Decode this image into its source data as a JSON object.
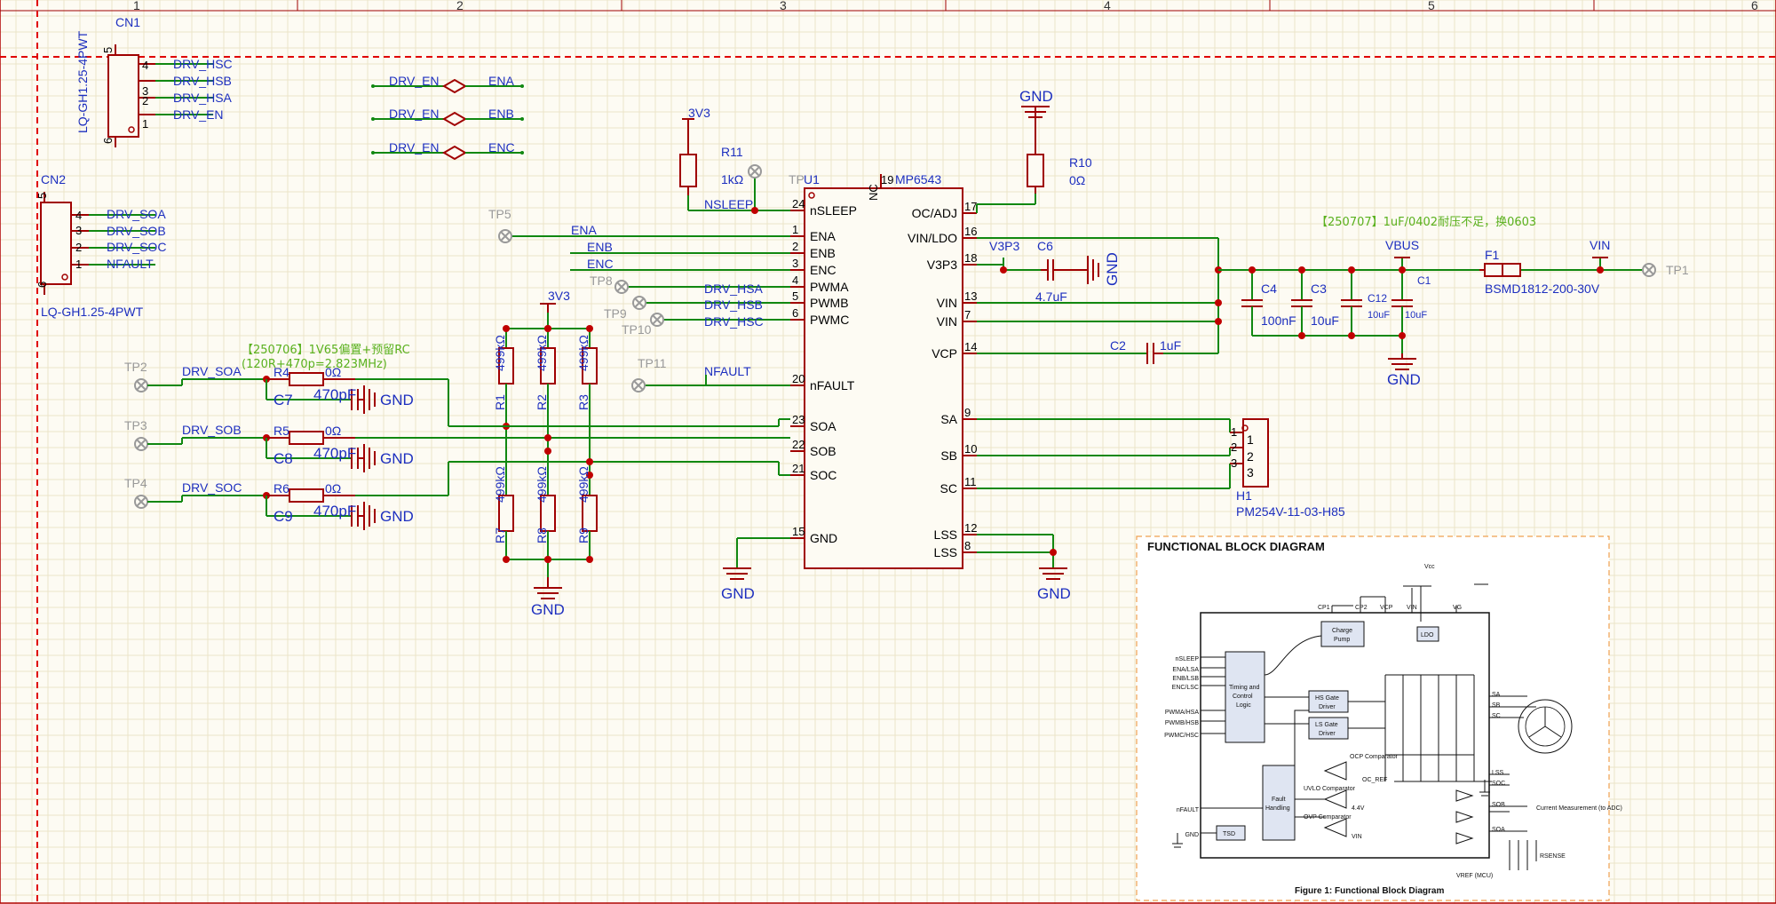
{
  "rulers": [
    "1",
    "2",
    "3",
    "4",
    "5",
    "6"
  ],
  "connectors": {
    "cn1": {
      "ref": "CN1",
      "part": "LQ-GH1.25-4PWT",
      "pins": [
        "4",
        "3",
        "2",
        "1"
      ],
      "mounts": [
        "5",
        "6"
      ],
      "nets": [
        "DRV_HSC",
        "DRV_HSB",
        "DRV_HSA",
        "DRV_EN"
      ]
    },
    "cn2": {
      "ref": "CN2",
      "part": "LQ-GH1.25-4PWT",
      "pins": [
        "4",
        "3",
        "2",
        "1"
      ],
      "mounts": [
        "5",
        "6"
      ],
      "nets": [
        "DRV_SOA",
        "DRV_SOB",
        "DRV_SOC",
        "NFAULT"
      ]
    }
  },
  "net_ties": [
    {
      "left": "DRV_EN",
      "right": "ENA"
    },
    {
      "left": "DRV_EN",
      "right": "ENB"
    },
    {
      "left": "DRV_EN",
      "right": "ENC"
    }
  ],
  "ic": {
    "ref": "U1",
    "part": "MP6543",
    "tp_ref": "TP",
    "nc_label": "NC",
    "nc_pin": "19",
    "left_pins": [
      {
        "num": "24",
        "name": "nSLEEP"
      },
      {
        "num": "1",
        "name": "ENA"
      },
      {
        "num": "2",
        "name": "ENB"
      },
      {
        "num": "3",
        "name": "ENC"
      },
      {
        "num": "4",
        "name": "PWMA"
      },
      {
        "num": "5",
        "name": "PWMB"
      },
      {
        "num": "6",
        "name": "PWMC"
      },
      {
        "num": "20",
        "name": "nFAULT"
      },
      {
        "num": "23",
        "name": "SOA"
      },
      {
        "num": "22",
        "name": "SOB"
      },
      {
        "num": "21",
        "name": "SOC"
      },
      {
        "num": "15",
        "name": "GND"
      }
    ],
    "right_pins": [
      {
        "num": "17",
        "name": "OC/ADJ"
      },
      {
        "num": "16",
        "name": "VIN/LDO"
      },
      {
        "num": "18",
        "name": "V3P3"
      },
      {
        "num": "13",
        "name": "VIN"
      },
      {
        "num": "7",
        "name": "VIN"
      },
      {
        "num": "14",
        "name": "VCP"
      },
      {
        "num": "9",
        "name": "SA"
      },
      {
        "num": "10",
        "name": "SB"
      },
      {
        "num": "11",
        "name": "SC"
      },
      {
        "num": "12",
        "name": "LSS"
      },
      {
        "num": "8",
        "name": "LSS"
      }
    ]
  },
  "nets": {
    "nsleep": "NSLEEP",
    "ena": "ENA",
    "enb": "ENB",
    "enc": "ENC",
    "drv_hsa": "DRV_HSA",
    "drv_hsb": "DRV_HSB",
    "drv_hsc": "DRV_HSC",
    "nfault": "NFAULT",
    "drv_soa": "DRV_SOA",
    "drv_sob": "DRV_SOB",
    "drv_soc": "DRV_SOC",
    "v3p3": "V3P3",
    "vbus": "VBUS",
    "vin_pwr": "VIN",
    "rail_3v3": "3V3"
  },
  "power": {
    "gnd": "GND"
  },
  "testpoints": [
    "TP1",
    "TP2",
    "TP3",
    "TP4",
    "TP5",
    "TP8",
    "TP9",
    "TP10",
    "TP11"
  ],
  "resistors": {
    "r11": {
      "ref": "R11",
      "value": "1kΩ"
    },
    "r10": {
      "ref": "R10",
      "value": "0Ω"
    },
    "r4": {
      "ref": "R4",
      "value": "0Ω"
    },
    "r5": {
      "ref": "R5",
      "value": "0Ω"
    },
    "r6": {
      "ref": "R6",
      "value": "0Ω"
    },
    "divider": [
      {
        "ref": "R1",
        "value": "499kΩ"
      },
      {
        "ref": "R2",
        "value": "499kΩ"
      },
      {
        "ref": "R3",
        "value": "499kΩ"
      },
      {
        "ref": "R7",
        "value": "499kΩ"
      },
      {
        "ref": "R8",
        "value": "499kΩ"
      },
      {
        "ref": "R9",
        "value": "499kΩ"
      }
    ]
  },
  "capacitors": {
    "c6": {
      "ref": "C6",
      "value": "4.7uF"
    },
    "c2": {
      "ref": "C2",
      "value": "1uF"
    },
    "c4": {
      "ref": "C4",
      "value": "100nF"
    },
    "c3": {
      "ref": "C3",
      "value": "10uF"
    },
    "c12": {
      "ref": "C12",
      "value": "10uF"
    },
    "c1": {
      "ref": "C1",
      "value": "10uF"
    },
    "c7": {
      "ref": "C7",
      "value": "470pF"
    },
    "c8": {
      "ref": "C8",
      "value": "470pF"
    },
    "c9": {
      "ref": "C9",
      "value": "470pF"
    }
  },
  "fuse": {
    "ref": "F1",
    "part": "BSMD1812-200-30V"
  },
  "header": {
    "ref": "H1",
    "part": "PM254V-11-03-H85",
    "pins": [
      "1",
      "2",
      "3"
    ],
    "pin_nums": [
      "1",
      "2",
      "3"
    ]
  },
  "notes": {
    "cap_note": "【250707】1uF/0402耐压不足，换0603",
    "rc_note": "【250706】1V65偏置+预留RC",
    "rc_note2": "(120R+470p=2.823MHz)"
  },
  "fbd": {
    "title": "FUNCTIONAL BLOCK DIAGRAM",
    "caption": "Figure 1: Functional Block Diagram",
    "blocks": {
      "timing": [
        "Timing and",
        "Control",
        "Logic"
      ],
      "charge": [
        "Charge",
        "Pump"
      ],
      "ldo": "LDO",
      "hs": [
        "HS Gate",
        "Driver"
      ],
      "ls": [
        "LS Gate",
        "Driver"
      ],
      "fault": [
        "Fault",
        "Handling"
      ],
      "tsd": "TSD"
    },
    "inputs": [
      "nSLEEP",
      "ENA/LSA",
      "ENB/LSB",
      "ENC/LSC",
      "PWMA/HSA",
      "PWMB/HSB",
      "PWMC/HSC",
      "nFAULT",
      "GND"
    ],
    "top_labels": [
      "CP1",
      "CP2",
      "VCP",
      "VIN",
      "VG",
      "Vcc"
    ],
    "outputs": [
      "SA",
      "SB",
      "SC",
      "LSS",
      "SOC",
      "SOB",
      "SOA"
    ],
    "comparators": [
      "OCP Comparator",
      "UVLO Comparator",
      "OVP Comparator"
    ],
    "refs": [
      "OC_REF",
      "4.4V",
      "VIN"
    ],
    "misc": [
      "Current Measurement (to ADC)",
      "VREF (MCU)",
      "RSENSE"
    ]
  }
}
